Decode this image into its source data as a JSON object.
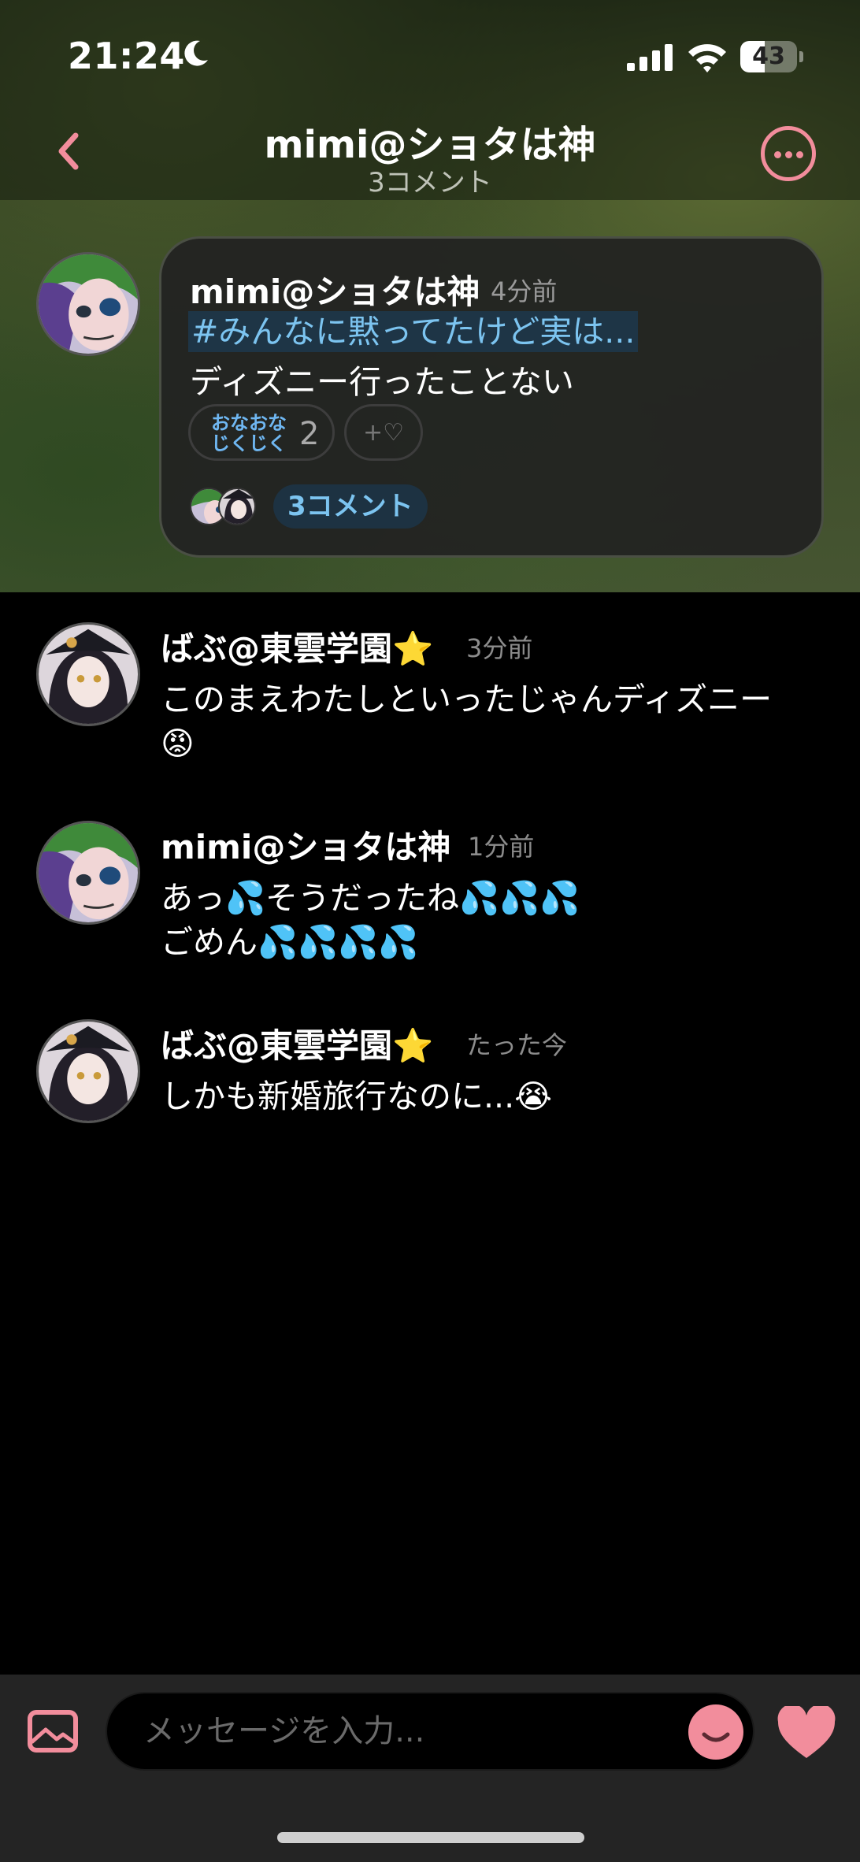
{
  "status": {
    "time": "21:24",
    "battery": "43",
    "battery_level": 0.43
  },
  "nav": {
    "title": "mimi@ショタは神",
    "subtitle": "3コメント"
  },
  "post": {
    "author": "mimi@ショタは神",
    "time": "4分前",
    "hashtag": "#みんなに黙ってたけど実は...",
    "body": "ディズニー行ったことない",
    "reaction_label_line1": "おなおな",
    "reaction_label_line2": "じくじく",
    "reaction_count": "2",
    "add_reaction": "+♡",
    "comment_count_label": "3コメント"
  },
  "comments": [
    {
      "author": "ばぶ@東雲学園⭐",
      "time": "3分前",
      "line1": "このまえわたしといったじゃんディズニー",
      "line2": "😡"
    },
    {
      "author": "mimi@ショタは神",
      "time": "1分前",
      "line1": "あっ💦そうだったね💦💦💦",
      "line2": "ごめん💦💦💦💦"
    },
    {
      "author": "ばぶ@東雲学園⭐",
      "time": "たった今",
      "line1": "しかも新婚旅行なのに...😭",
      "line2": ""
    }
  ],
  "input": {
    "placeholder": "メッセージを入力..."
  },
  "colors": {
    "accent": "#f28d9c",
    "hashtag": "#7cc4f0",
    "background": "#000000",
    "card": "#222222"
  }
}
